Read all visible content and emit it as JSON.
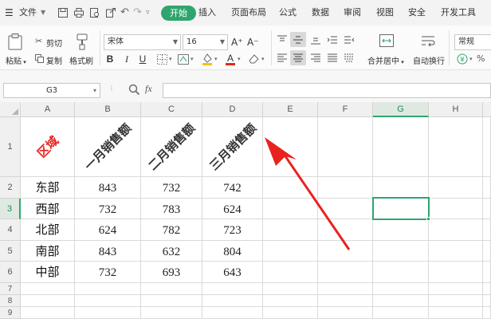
{
  "menubar": {
    "file": "文件",
    "tabs": [
      "插入",
      "页面布局",
      "公式",
      "数据",
      "审阅",
      "视图",
      "安全",
      "开发工具"
    ],
    "active_tab": "开始",
    "accent": "#2fa56e"
  },
  "ribbon": {
    "paste": "粘贴",
    "cut": "剪切",
    "copy": "复制",
    "format_painter": "格式刷",
    "font_name": "宋体",
    "font_size": "16",
    "bold": "B",
    "italic": "I",
    "underline": "U",
    "grow_font": "A⁺",
    "shrink_font": "A⁻",
    "merge_center": "合并居中",
    "auto_wrap": "自动换行",
    "number_format": "常规"
  },
  "formula_bar": {
    "name_box": "G3",
    "fx": "fx",
    "value": ""
  },
  "sheet": {
    "columns": [
      "A",
      "B",
      "C",
      "D",
      "E",
      "F",
      "G",
      "H"
    ],
    "rows": [
      "1",
      "2",
      "3",
      "4",
      "5",
      "6",
      "7",
      "8",
      "9"
    ],
    "selected_cell": "G3",
    "header_row": [
      "区域",
      "一月销售额",
      "二月销售额",
      "三月销售额"
    ],
    "data": [
      [
        "东部",
        "843",
        "732",
        "742"
      ],
      [
        "西部",
        "732",
        "783",
        "624"
      ],
      [
        "北部",
        "624",
        "782",
        "723"
      ],
      [
        "南部",
        "843",
        "632",
        "804"
      ],
      [
        "中部",
        "732",
        "693",
        "643"
      ]
    ],
    "header_colors": {
      "region": "#e8231f",
      "sales": "#111111"
    },
    "annotation_color": "#e8231f"
  }
}
